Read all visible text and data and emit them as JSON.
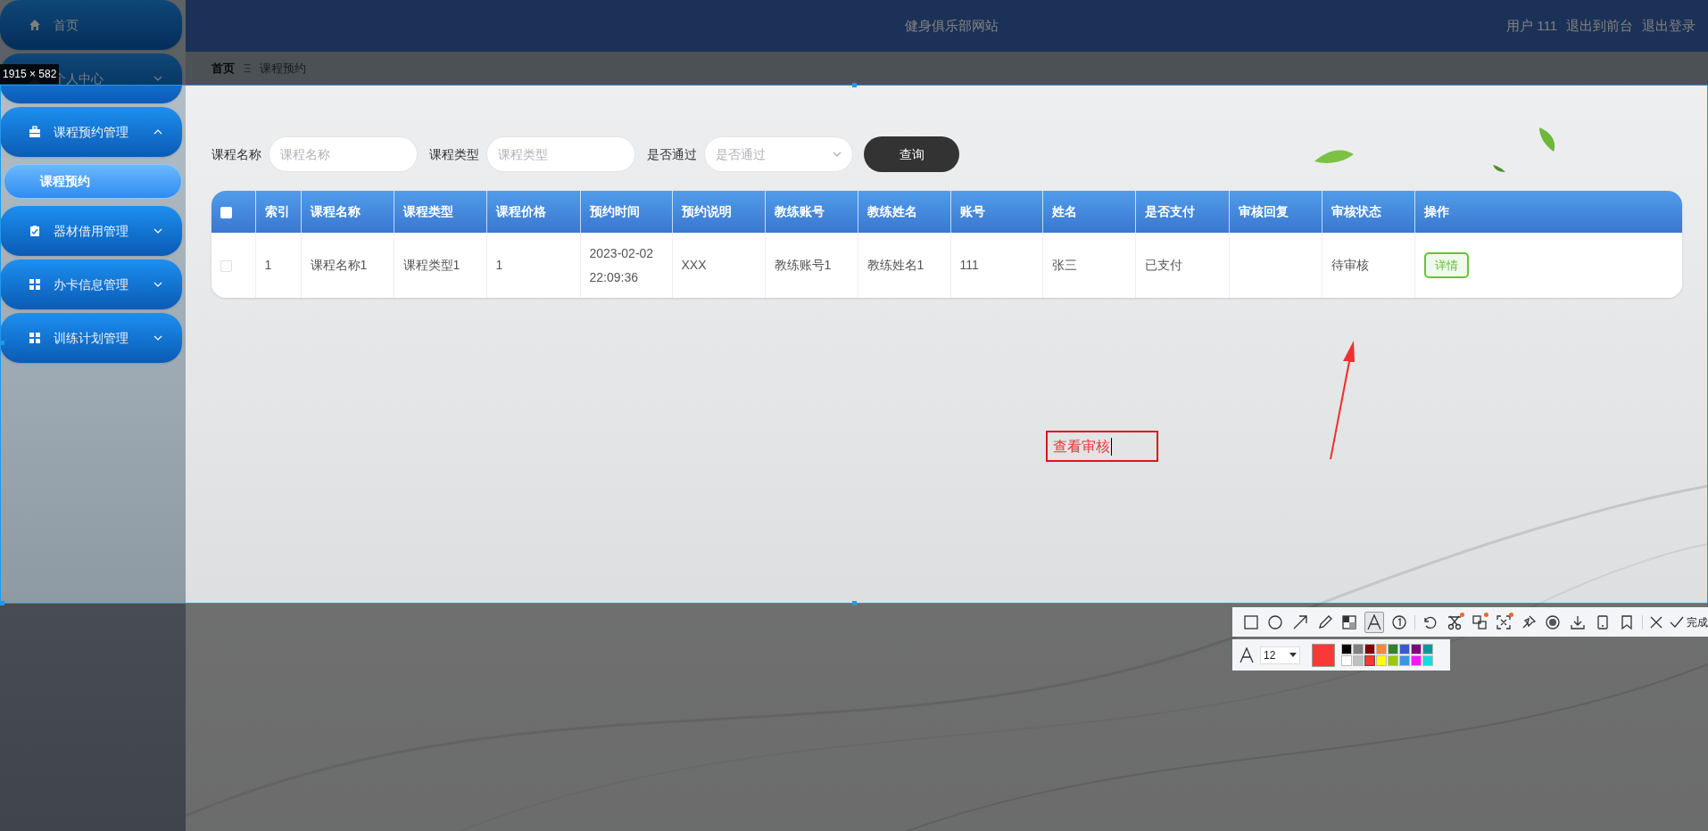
{
  "capture": {
    "size_label": "1915 × 582"
  },
  "header": {
    "title": "健身俱乐部网站",
    "links": [
      "用户 111",
      "退出到前台",
      "退出登录"
    ]
  },
  "sidebar": {
    "items": [
      {
        "label": "首页",
        "kind": "link"
      },
      {
        "label": "个人中心",
        "kind": "menu",
        "expanded": false
      },
      {
        "label": "课程预约管理",
        "kind": "menu",
        "expanded": true,
        "children": [
          {
            "label": "课程预约",
            "selected": true
          }
        ]
      },
      {
        "label": "器材借用管理",
        "kind": "menu",
        "expanded": false
      },
      {
        "label": "办卡信息管理",
        "kind": "menu",
        "expanded": false
      },
      {
        "label": "训练计划管理",
        "kind": "menu",
        "expanded": false
      }
    ]
  },
  "breadcrumb": {
    "items": [
      "首页",
      "课程预约"
    ],
    "separator": "Ξ"
  },
  "search": {
    "fields": [
      {
        "label": "课程名称",
        "placeholder": "课程名称",
        "kind": "input"
      },
      {
        "label": "课程类型",
        "placeholder": "课程类型",
        "kind": "input"
      },
      {
        "label": "是否通过",
        "placeholder": "是否通过",
        "kind": "select"
      }
    ],
    "button": "查询"
  },
  "table": {
    "header_checked": false,
    "columns": [
      "索引",
      "课程名称",
      "课程类型",
      "课程价格",
      "预约时间",
      "预约说明",
      "教练账号",
      "教练姓名",
      "账号",
      "姓名",
      "是否支付",
      "审核回复",
      "审核状态",
      "操作"
    ],
    "rows": [
      {
        "checked": false,
        "cells": [
          "1",
          "课程名称1",
          "课程类型1",
          "1",
          "2023-02-02 22:09:36",
          "XXX",
          "教练账号1",
          "教练姓名1",
          "111",
          "张三",
          "已支付",
          null,
          "待审核"
        ],
        "action": "详情"
      }
    ]
  },
  "annotation": {
    "text": "查看审核"
  },
  "toolbar": {
    "tools": [
      {
        "selected": false,
        "badge": false
      },
      {
        "selected": false,
        "badge": false
      },
      {
        "selected": false,
        "badge": false
      },
      {
        "selected": false,
        "badge": false
      },
      {
        "selected": false,
        "badge": false
      },
      {
        "selected": true,
        "badge": false
      },
      {
        "selected": false,
        "badge": false
      },
      {
        "selected": false,
        "badge": false
      },
      {
        "selected": false,
        "badge": true
      },
      {
        "selected": false,
        "badge": true
      },
      {
        "selected": false,
        "badge": true
      },
      {
        "selected": false,
        "badge": false
      },
      {
        "selected": false,
        "badge": false
      },
      {
        "selected": false,
        "badge": false
      },
      {
        "selected": false,
        "badge": false
      },
      {
        "selected": false,
        "badge": false
      }
    ],
    "done": "完成",
    "font_size": "12",
    "palette": [
      {
        "color": "#000000",
        "selected": false
      },
      {
        "color": "#808080",
        "selected": false
      },
      {
        "color": "#800000",
        "selected": false
      },
      {
        "color": "#f7883a",
        "selected": false
      },
      {
        "color": "#308430",
        "selected": false
      },
      {
        "color": "#385ad3",
        "selected": false
      },
      {
        "color": "#800080",
        "selected": false
      },
      {
        "color": "#009999",
        "selected": false
      },
      {
        "color": "#ffffff",
        "selected": false
      },
      {
        "color": "#c0c0c0",
        "selected": false
      },
      {
        "color": "#fb3838",
        "selected": true
      },
      {
        "color": "#ffff00",
        "selected": false
      },
      {
        "color": "#99cc00",
        "selected": false
      },
      {
        "color": "#3d95e1",
        "selected": false
      },
      {
        "color": "#f31bf3",
        "selected": false
      },
      {
        "color": "#16dcdc",
        "selected": false
      }
    ]
  }
}
